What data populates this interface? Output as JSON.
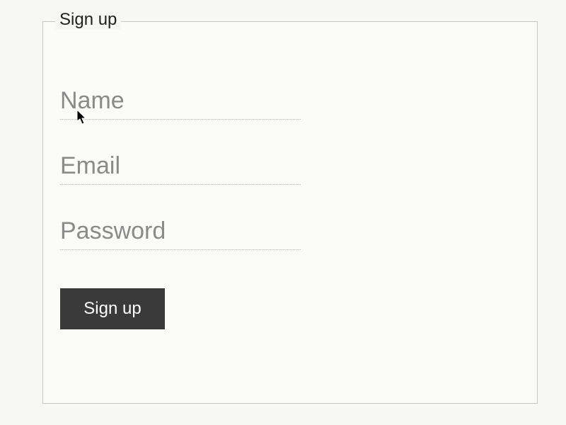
{
  "form": {
    "legend": "Sign up",
    "fields": {
      "name": {
        "placeholder": "Name",
        "value": ""
      },
      "email": {
        "placeholder": "Email",
        "value": ""
      },
      "password": {
        "placeholder": "Password",
        "value": ""
      }
    },
    "submit_label": "Sign up"
  }
}
